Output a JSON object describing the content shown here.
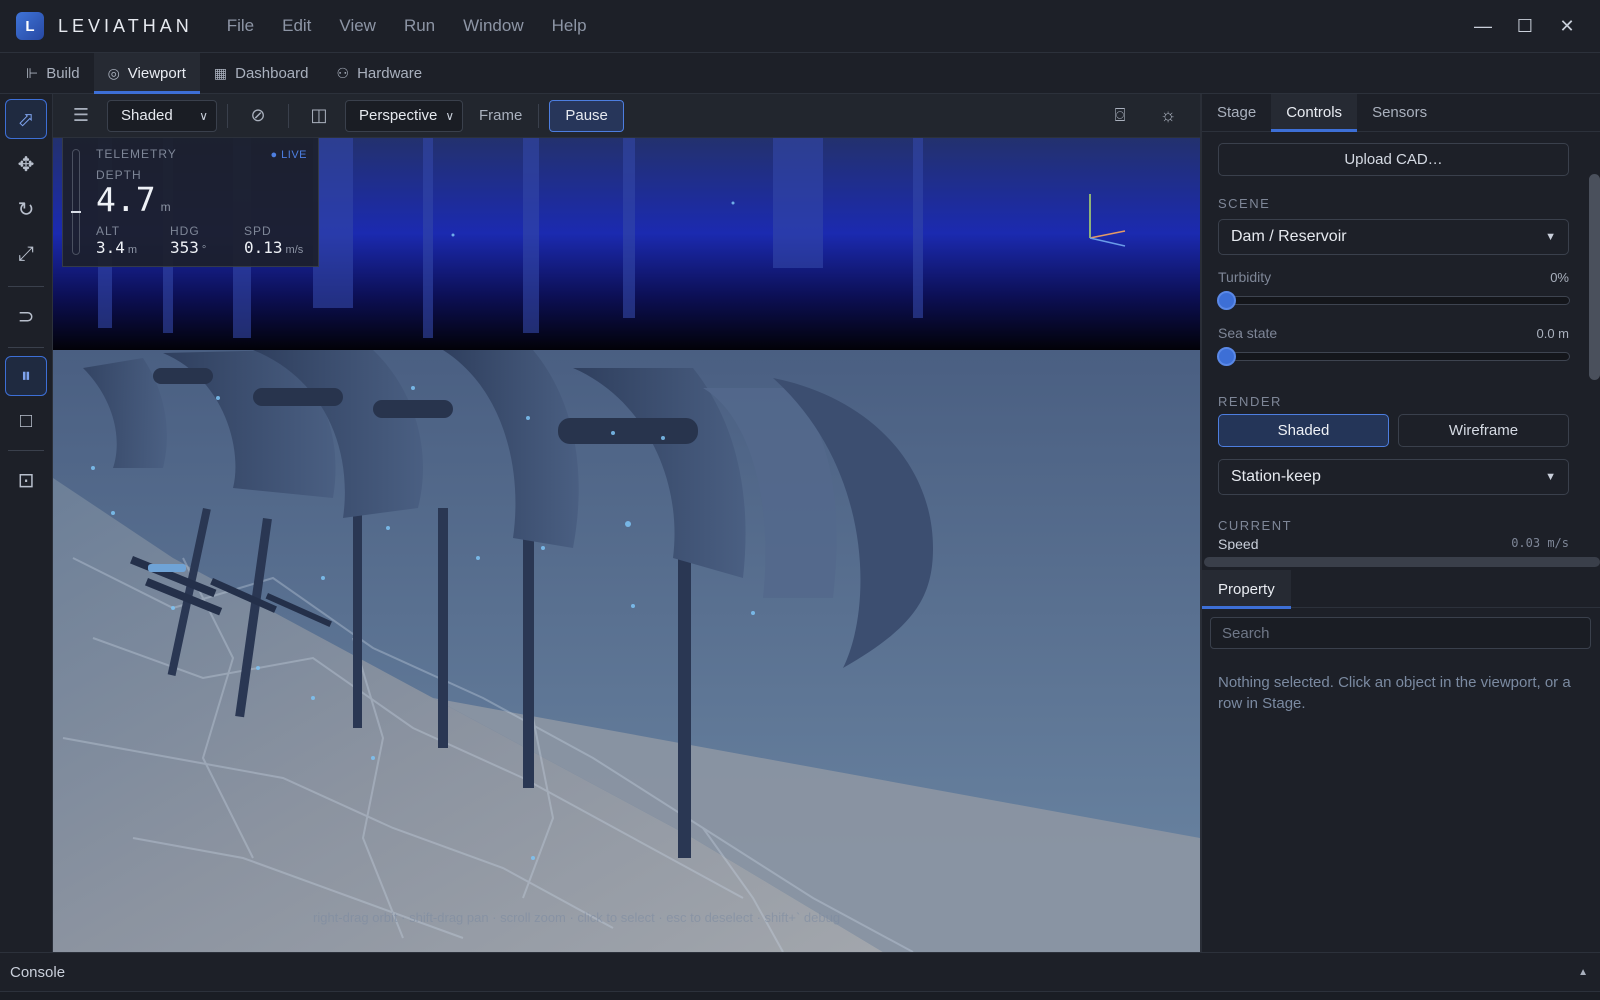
{
  "app": {
    "logo": "L",
    "title": "LEVIATHAN",
    "menu": [
      "File",
      "Edit",
      "View",
      "Run",
      "Window",
      "Help"
    ]
  },
  "window_controls": {
    "minimize": "—",
    "maximize": "☐",
    "close": "✕"
  },
  "tabs": [
    {
      "label": "Build",
      "icon": "hierarchy-icon",
      "glyph": "⊩"
    },
    {
      "label": "Viewport",
      "icon": "viewport-icon",
      "glyph": "◎"
    },
    {
      "label": "Dashboard",
      "icon": "dashboard-icon",
      "glyph": "▦"
    },
    {
      "label": "Hardware",
      "icon": "hardware-icon",
      "glyph": "⚇"
    }
  ],
  "active_tab": "Viewport",
  "left_toolbar": [
    {
      "name": "select-tool",
      "glyph": "⬀",
      "active": true
    },
    {
      "name": "move-tool",
      "glyph": "✥"
    },
    {
      "name": "rotate-tool",
      "glyph": "↻"
    },
    {
      "name": "scale-tool",
      "glyph": "⤢"
    },
    {
      "name": "magnet-tool",
      "glyph": "⊃"
    },
    {
      "name": "pause-tool",
      "glyph": "⏸",
      "active": true
    },
    {
      "name": "stop-tool",
      "glyph": "□"
    },
    {
      "name": "focus-tool",
      "glyph": "⊡"
    }
  ],
  "viewport_toolbar": {
    "settings_icon": "sliders-icon",
    "render_mode": "Shaded",
    "visibility_icon": "eye-off-icon",
    "camera_icon": "camera-icon",
    "projection": "Perspective",
    "frame_label": "Frame",
    "pause_label": "Pause",
    "screenshot_icon": "screenshot-icon",
    "lighting_icon": "sun-icon"
  },
  "telemetry": {
    "title": "TELEMETRY",
    "live": "LIVE",
    "depth_label": "DEPTH",
    "depth": "4.7",
    "depth_unit": "m",
    "alt_label": "ALT",
    "alt": "3.4",
    "alt_unit": "m",
    "hdg_label": "HDG",
    "hdg": "353",
    "hdg_unit": "°",
    "spd_label": "SPD",
    "spd": "0.13",
    "spd_unit": "m/s"
  },
  "viewport_hint": "right-drag orbit · shift-drag pan · scroll zoom · click to select · esc to deselect · shift+` debug",
  "right_panel": {
    "tabs": [
      "Stage",
      "Controls",
      "Sensors"
    ],
    "active_tab": "Controls",
    "upload_cad": "Upload CAD…",
    "scene_section": "SCENE",
    "scene_value": "Dam / Reservoir",
    "turbidity_label": "Turbidity",
    "turbidity_value": "0%",
    "turbidity_level": 0,
    "sea_state_label": "Sea state",
    "sea_state_value": "0.0 m",
    "sea_state_level": 0,
    "render_section": "RENDER",
    "render_shaded": "Shaded",
    "render_wireframe": "Wireframe",
    "mode_value": "Station-keep",
    "current_section": "CURRENT",
    "speed_label": "Speed",
    "speed_value": "0.03 m/s"
  },
  "property_panel": {
    "tab": "Property",
    "search_placeholder": "Search",
    "empty_text": "Nothing selected. Click an object in the viewport, or a row in Stage."
  },
  "console": {
    "label": "Console",
    "chevron": "▲"
  },
  "colors": {
    "accent": "#3d6fd6",
    "bg": "#1c1f26",
    "panel": "#1d2028",
    "water": "#405878"
  }
}
